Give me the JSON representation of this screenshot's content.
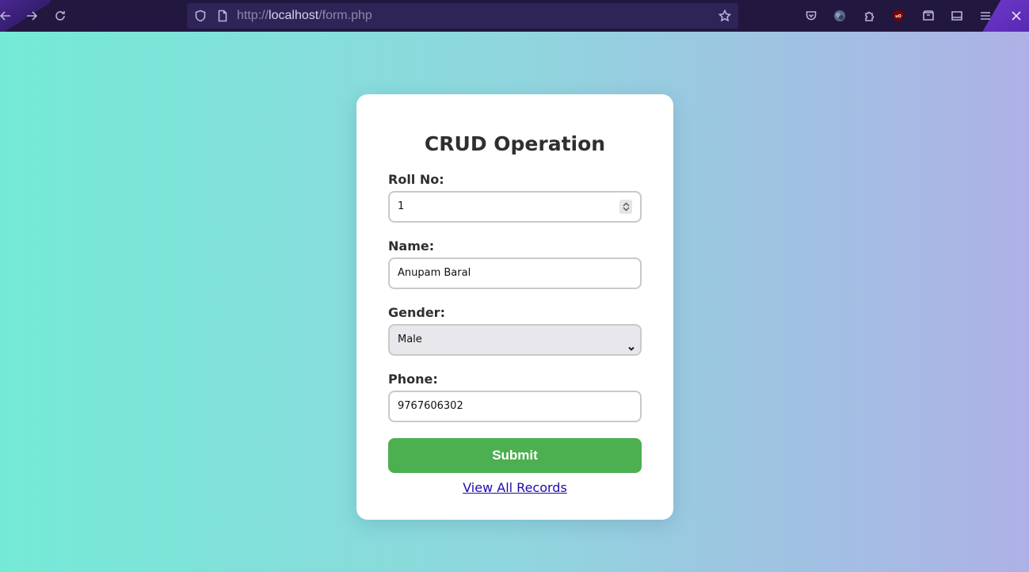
{
  "browser": {
    "url_prefix": "http://",
    "url_host": "localhost",
    "url_path": "/form.php"
  },
  "form": {
    "title": "CRUD Operation",
    "roll_label": "Roll No:",
    "roll_value": "1",
    "name_label": "Name:",
    "name_value": "Anupam Baral",
    "gender_label": "Gender:",
    "gender_value": "Male",
    "phone_label": "Phone:",
    "phone_value": "9767606302",
    "submit_label": "Submit",
    "view_link": "View All Records"
  },
  "colors": {
    "accent": "#4caf50",
    "link": "#1a0dab",
    "toolbar": "#21173f"
  },
  "icons": [
    "back-icon",
    "forward-icon",
    "reload-icon",
    "shield-icon",
    "page-icon",
    "bookmark-star-icon",
    "pocket-icon",
    "profile-icon",
    "extensions-icon",
    "ublock-icon",
    "container-icon",
    "sidebar-icon",
    "menu-icon",
    "close-icon"
  ]
}
